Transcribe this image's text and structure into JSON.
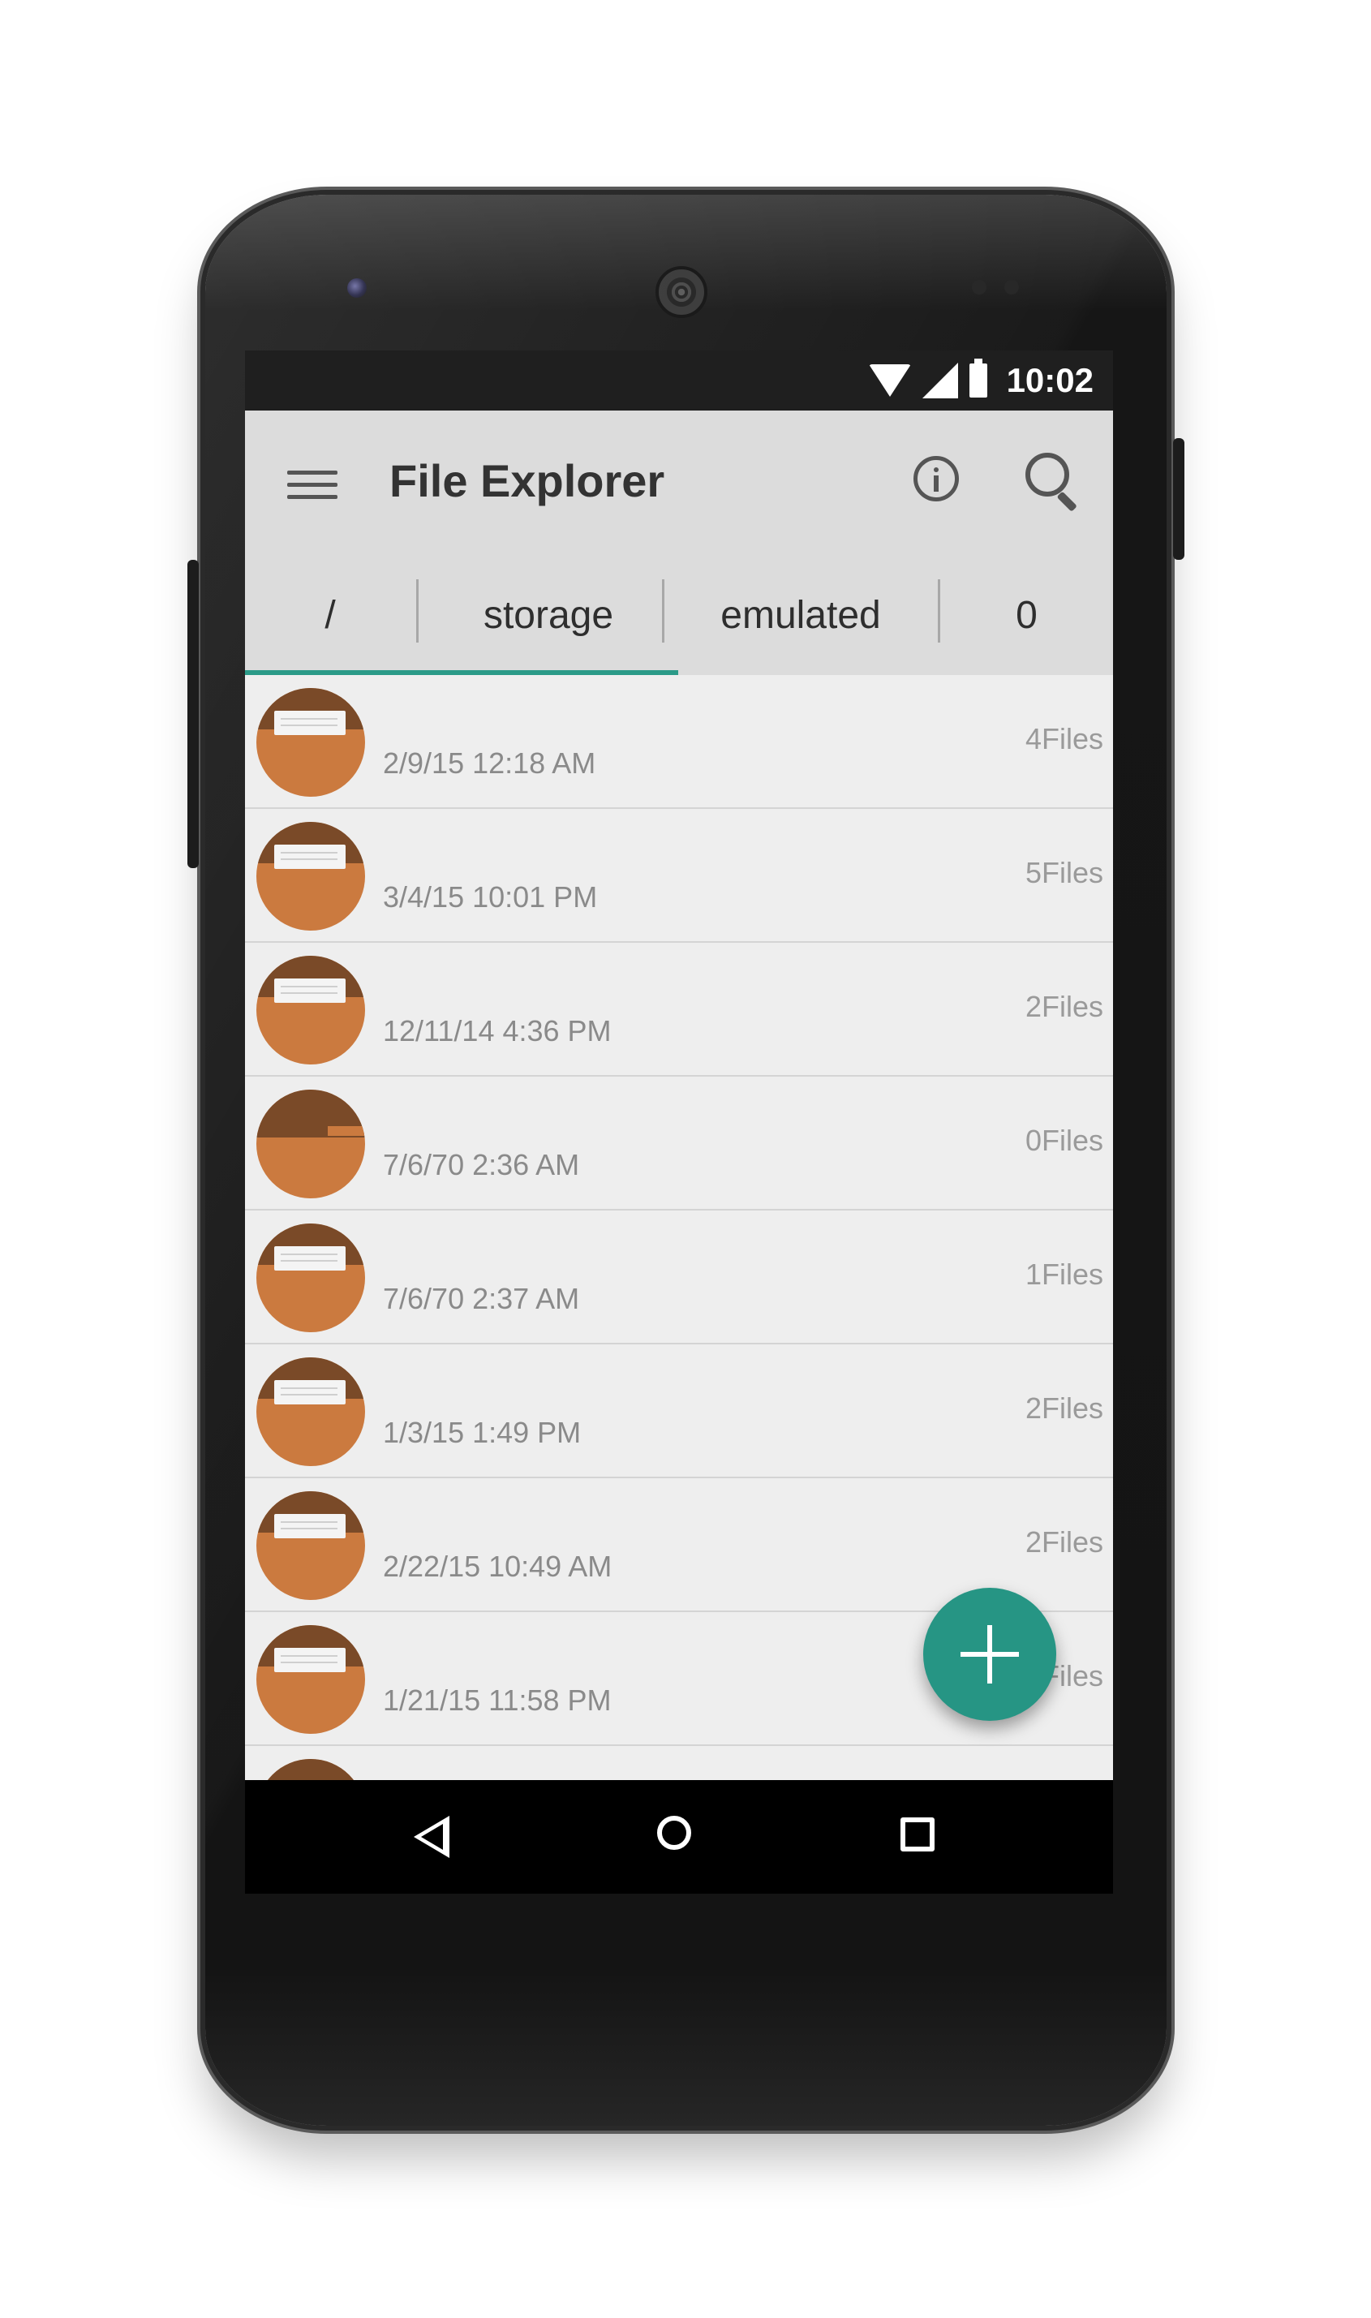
{
  "status_bar": {
    "time": "10:02"
  },
  "app_bar": {
    "title": "File Explorer"
  },
  "breadcrumb": [
    {
      "label": "/"
    },
    {
      "label": "storage"
    },
    {
      "label": "emulated"
    },
    {
      "label": "0"
    }
  ],
  "files": [
    {
      "date": "2/9/15 12:18 AM",
      "count": "4Files"
    },
    {
      "date": "3/4/15 10:01 PM",
      "count": "5Files"
    },
    {
      "date": "12/11/14 4:36 PM",
      "count": "2Files"
    },
    {
      "date": "7/6/70 2:36 AM",
      "count": "0Files"
    },
    {
      "date": "7/6/70 2:37 AM",
      "count": "1Files"
    },
    {
      "date": "1/3/15 1:49 PM",
      "count": "2Files"
    },
    {
      "date": "2/22/15 10:49 AM",
      "count": "2Files"
    },
    {
      "date": "1/21/15 11:58 PM",
      "count": "2Files"
    }
  ],
  "colors": {
    "accent": "#269584",
    "appbar": "#dcdcdc",
    "folder": "#cb7a3f",
    "folder_dark": "#7a4a28"
  }
}
